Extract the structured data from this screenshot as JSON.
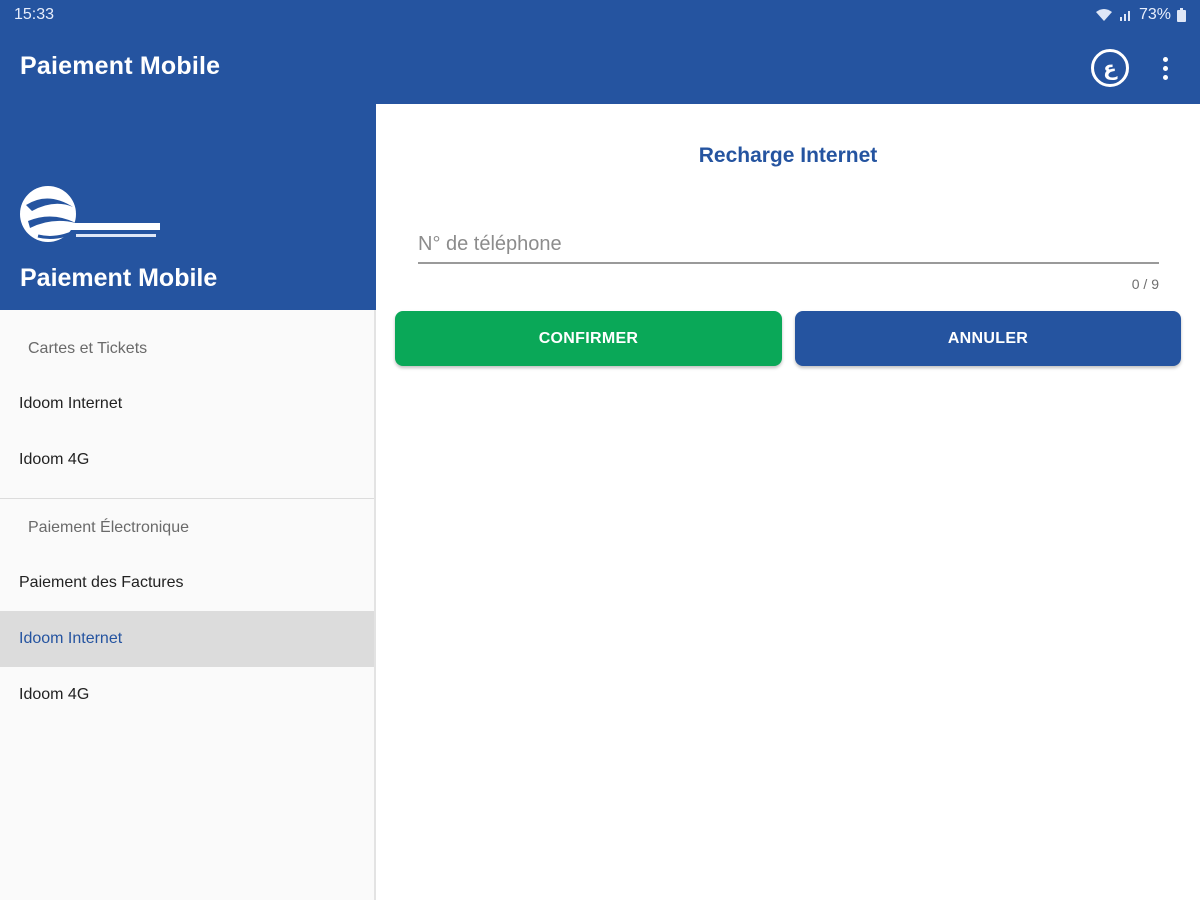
{
  "status_bar": {
    "time": "15:33",
    "battery": "73%"
  },
  "toolbar": {
    "title": "Paiement Mobile",
    "lang_button": "ع",
    "more_icon": "more-vertical-icon"
  },
  "drawer": {
    "header_title": "Paiement Mobile",
    "logo_icon": "algerie-telecom-logo",
    "sections": [
      {
        "title": "Cartes et Tickets",
        "items": [
          {
            "label": "Idoom Internet"
          },
          {
            "label": "Idoom 4G"
          }
        ]
      },
      {
        "title": "Paiement Électronique",
        "items": [
          {
            "label": "Paiement des Factures"
          },
          {
            "label": "Idoom Internet"
          },
          {
            "label": "Idoom 4G"
          }
        ]
      }
    ]
  },
  "form": {
    "title": "Recharge Internet",
    "phone_placeholder": "N° de téléphone",
    "phone_value": "",
    "counter": "0 / 9",
    "confirm_label": "CONFIRMER",
    "cancel_label": "ANNULER"
  },
  "colors": {
    "primary": "#2554a0",
    "confirm": "#0aa858",
    "active_item_bg": "#dcdcdc"
  }
}
